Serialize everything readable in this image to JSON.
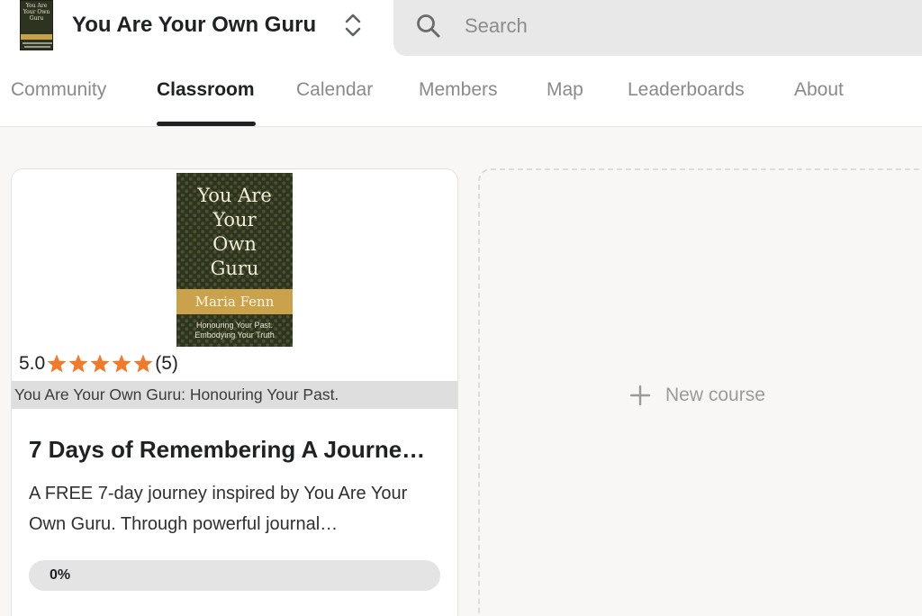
{
  "header": {
    "group_title": "You Are Your Own Guru",
    "logo": {
      "title": "You Are Your Own Guru",
      "author": "Maria Fenn"
    },
    "switcher_icon": "chevron-up-down-icon",
    "search": {
      "placeholder": "Search",
      "value": "",
      "icon": "search-icon"
    }
  },
  "nav": {
    "active": "Classroom",
    "tabs": [
      {
        "label": "Community"
      },
      {
        "label": "Classroom"
      },
      {
        "label": "Calendar"
      },
      {
        "label": "Members"
      },
      {
        "label": "Map"
      },
      {
        "label": "Leaderboards"
      },
      {
        "label": "About"
      }
    ]
  },
  "course": {
    "cover": {
      "title": "You Are\nYour\nOwn\nGuru",
      "author": "Maria Fenn",
      "subtitle": "Honouring Your Past.\nEmbodying Your Truth"
    },
    "rating": {
      "value": "5.0",
      "stars": 5,
      "count": "(5)",
      "star_color": "#f07b2c"
    },
    "caption": "You Are Your Own Guru: Honouring Your Past.",
    "title": "7 Days of Remembering A Journe…",
    "description": "A FREE 7-day journey inspired by You Are Your Own Guru. Through powerful journal…",
    "progress": {
      "label": "0%",
      "value": 0
    }
  },
  "new_course": {
    "label": "New course",
    "icon": "plus-icon"
  },
  "colors": {
    "accent": "#202124",
    "star": "#f07b2c",
    "book_band": "#c9a24b",
    "book_background": "#2f3421"
  }
}
